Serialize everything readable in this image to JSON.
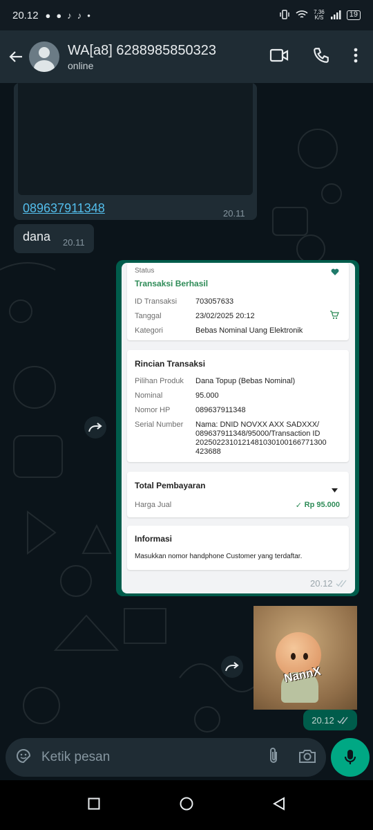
{
  "status_bar": {
    "time": "20.12",
    "net_speed_top": "7,36",
    "net_speed_bottom": "K/S",
    "battery": "19"
  },
  "header": {
    "contact_name": "WA[a8] 6288985850323",
    "status": "online"
  },
  "messages": {
    "incoming_link": {
      "phone": "089637911348",
      "time": "20.11"
    },
    "incoming_text": {
      "text": "dana",
      "time": "20.11"
    },
    "receipt": {
      "status_label": "Status",
      "status_value": "Transaksi Berhasil",
      "id_label": "ID Transaksi",
      "id_value": "703057633",
      "date_label": "Tanggal",
      "date_value": "23/02/2025 20:12",
      "category_label": "Kategori",
      "category_value": "Bebas Nominal Uang Elektronik",
      "details_title": "Rincian Transaksi",
      "product_label": "Pilihan Produk",
      "product_value": "Dana Topup (Bebas Nominal)",
      "nominal_label": "Nominal",
      "nominal_value": "95.000",
      "hp_label": "Nomor HP",
      "hp_value": "089637911348",
      "serial_label": "Serial Number",
      "serial_line1": "Nama: DNID NOVXX AXX SADXXX/",
      "serial_line2": "089637911348/95000/Transaction ID",
      "serial_line3": "2025022310121481030100166771300",
      "serial_line4": "423688",
      "total_title": "Total Pembayaran",
      "price_label": "Harga Jual",
      "price_value": "Rp 95.000",
      "info_title": "Informasi",
      "info_text": "Masukkan nomor handphone Customer yang terdaftar.",
      "time": "20.12"
    },
    "sticker": {
      "label": "NannX",
      "time": "20.12"
    }
  },
  "input": {
    "placeholder": "Ketik pesan"
  },
  "colors": {
    "header_bg": "#1f2c34",
    "chat_bg": "#0b141a",
    "outgoing_bubble": "#005c4b",
    "accent_green": "#00a884",
    "link_blue": "#53bdeb"
  }
}
